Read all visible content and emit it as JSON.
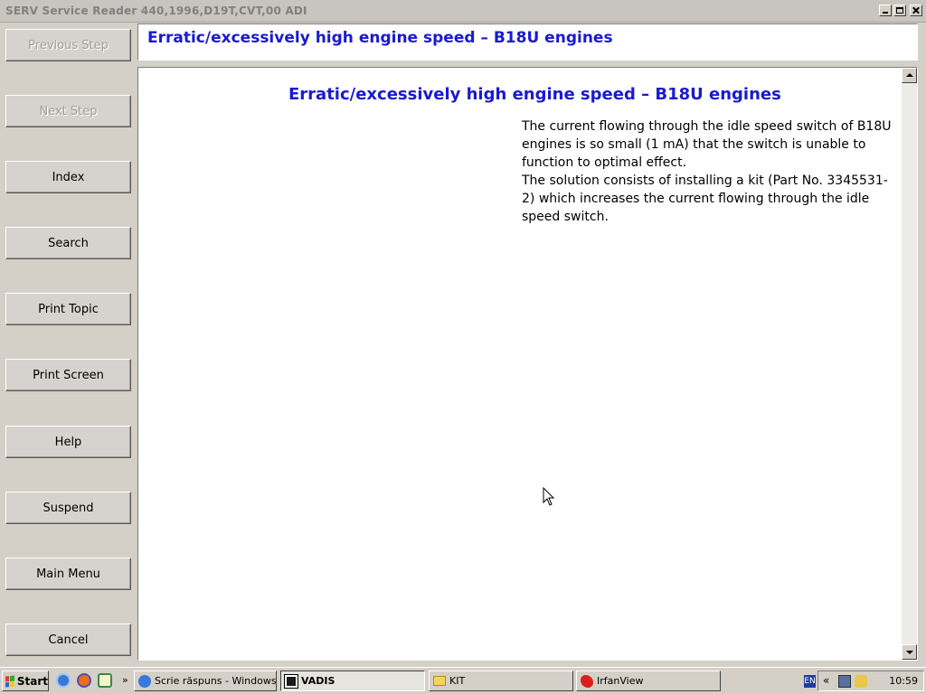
{
  "window": {
    "title": "SERV Service Reader 440,1996,D19T,CVT,00 ADI"
  },
  "sidebar": {
    "buttons": [
      {
        "label": "Previous Step",
        "enabled": false
      },
      {
        "label": "Next Step",
        "enabled": false
      },
      {
        "label": "Index",
        "enabled": true
      },
      {
        "label": "Search",
        "enabled": true
      },
      {
        "label": "Print Topic",
        "enabled": true
      },
      {
        "label": "Print Screen",
        "enabled": true
      },
      {
        "label": "Help",
        "enabled": true
      },
      {
        "label": "Suspend",
        "enabled": true
      },
      {
        "label": "Main Menu",
        "enabled": true
      },
      {
        "label": "Cancel",
        "enabled": true
      }
    ]
  },
  "header": {
    "title": "Erratic/excessively high engine speed – B18U engines"
  },
  "content": {
    "title": "Erratic/excessively high engine speed – B18U engines",
    "paragraph1": "The current flowing through the idle speed switch of B18U engines is so small (1 mA) that the switch is unable to function to optimal effect.",
    "paragraph2": "The solution consists of installing a kit (Part No. 3345531-2) which increases the current flowing through the idle speed switch."
  },
  "taskbar": {
    "start_label": "Start",
    "tasks": [
      {
        "label": "Scrie răspuns - Windows ...",
        "icon": "ie-icon"
      },
      {
        "label": "VADIS",
        "icon": "vadis-icon",
        "active": true
      },
      {
        "label": "KIT",
        "icon": "folder-icon"
      },
      {
        "label": "IrfanView",
        "icon": "irfanview-icon"
      }
    ],
    "lang": "EN",
    "clock": "10:59"
  },
  "colors": {
    "heading": "#1a1ad0",
    "window_bg": "#d4d0c8"
  }
}
